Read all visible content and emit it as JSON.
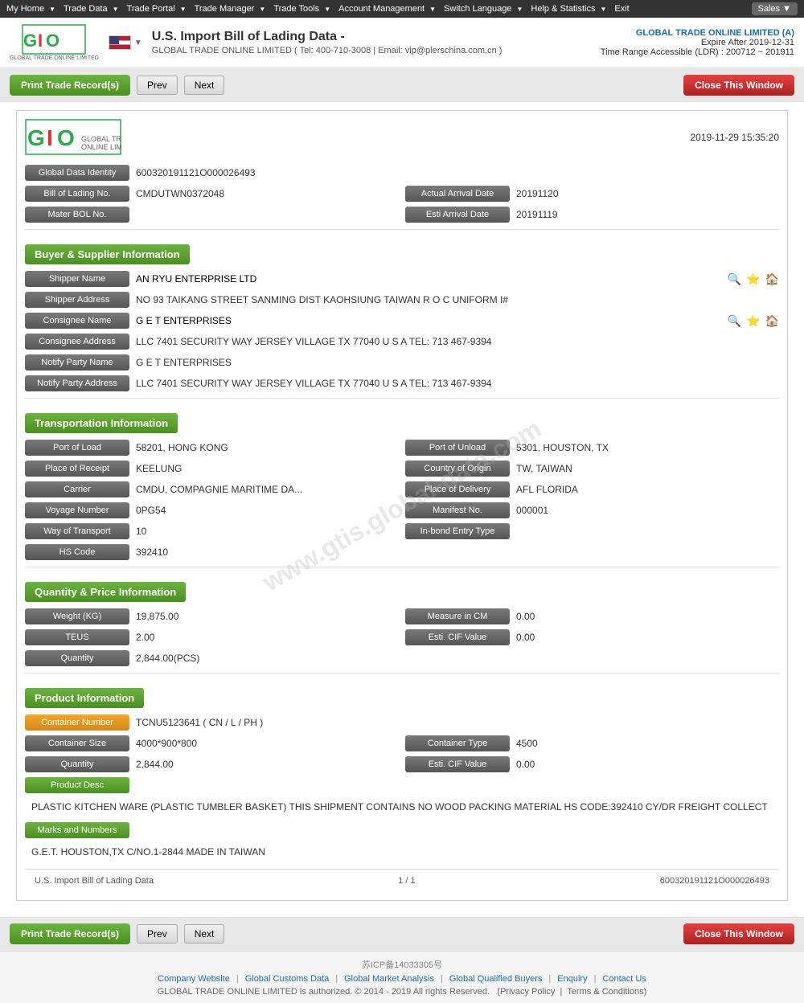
{
  "topnav": {
    "items": [
      {
        "label": "My Home",
        "hasArrow": true
      },
      {
        "label": "Trade Data",
        "hasArrow": true
      },
      {
        "label": "Trade Portal",
        "hasArrow": true
      },
      {
        "label": "Trade Manager",
        "hasArrow": true
      },
      {
        "label": "Trade Tools",
        "hasArrow": true
      },
      {
        "label": "Account Management",
        "hasArrow": true
      },
      {
        "label": "Switch Language",
        "hasArrow": true
      },
      {
        "label": "Help & Statistics",
        "hasArrow": true
      },
      {
        "label": "Exit",
        "hasArrow": false
      }
    ],
    "sales_label": "Sales"
  },
  "header": {
    "title": "U.S. Import Bill of Lading Data",
    "dash": "-",
    "company_info": "GLOBAL TRADE ONLINE LIMITED ( Tel: 400-710-3008 | Email: vip@plerschina.com.cn )",
    "account_name": "GLOBAL TRADE ONLINE LIMITED (A)",
    "expire": "Expire After 2019-12-31",
    "ldr": "Time Range Accessible (LDR) : 200712 ~ 201911",
    "logo_text": "GLOBAL TRADE ONLINE LIMITED"
  },
  "toolbar": {
    "print_label": "Print Trade Record(s)",
    "prev_label": "Prev",
    "next_label": "Next",
    "close_label": "Close This Window"
  },
  "record": {
    "timestamp": "2019-11-29 15:35:20",
    "global_data_identity_label": "Global Data Identity",
    "global_data_identity_value": "600320191121O000026493",
    "bill_of_lading_label": "Bill of Lading No.",
    "bill_of_lading_value": "CMDUTWN0372048",
    "actual_arrival_label": "Actual Arrival Date",
    "actual_arrival_value": "20191120",
    "master_bol_label": "Mater BOL No.",
    "master_bol_value": "",
    "esti_arrival_label": "Esti Arrival Date",
    "esti_arrival_value": "20191119",
    "sections": {
      "buyer_supplier": {
        "title": "Buyer & Supplier Information",
        "shipper_name_label": "Shipper Name",
        "shipper_name_value": "AN RYU ENTERPRISE LTD",
        "shipper_address_label": "Shipper Address",
        "shipper_address_value": "NO 93 TAIKANG STREET SANMING DIST KAOHSIUNG TAIWAN R O C UNIFORM I#",
        "consignee_name_label": "Consignee Name",
        "consignee_name_value": "G E T ENTERPRISES",
        "consignee_address_label": "Consignee Address",
        "consignee_address_value": "LLC 7401 SECURITY WAY JERSEY VILLAGE TX 77040 U S A TEL: 713 467-9394",
        "notify_party_name_label": "Notify Party Name",
        "notify_party_name_value": "G E T ENTERPRISES",
        "notify_party_address_label": "Notify Party Address",
        "notify_party_address_value": "LLC 7401 SECURITY WAY JERSEY VILLAGE TX 77040 U S A TEL: 713 467-9394"
      },
      "transportation": {
        "title": "Transportation Information",
        "port_of_load_label": "Port of Load",
        "port_of_load_value": "58201, HONG KONG",
        "port_of_unload_label": "Port of Unload",
        "port_of_unload_value": "5301, HOUSTON, TX",
        "place_of_receipt_label": "Place of Receipt",
        "place_of_receipt_value": "KEELUNG",
        "country_of_origin_label": "Country of Origin",
        "country_of_origin_value": "TW, TAIWAN",
        "carrier_label": "Carrier",
        "carrier_value": "CMDU, COMPAGNIE MARITIME DA...",
        "place_of_delivery_label": "Place of Delivery",
        "place_of_delivery_value": "AFL FLORIDA",
        "voyage_number_label": "Voyage Number",
        "voyage_number_value": "0PG54",
        "manifest_no_label": "Manifest No.",
        "manifest_no_value": "000001",
        "way_of_transport_label": "Way of Transport",
        "way_of_transport_value": "10",
        "inbond_entry_label": "In-bond Entry Type",
        "inbond_entry_value": "",
        "hs_code_label": "HS Code",
        "hs_code_value": "392410"
      },
      "quantity_price": {
        "title": "Quantity & Price Information",
        "weight_label": "Weight (KG)",
        "weight_value": "19,875.00",
        "measure_label": "Measure in CM",
        "measure_value": "0.00",
        "teus_label": "TEUS",
        "teus_value": "2.00",
        "esti_cif_label": "Esti. CIF Value",
        "esti_cif_value": "0.00",
        "quantity_label": "Quantity",
        "quantity_value": "2,844.00(PCS)"
      },
      "product": {
        "title": "Product Information",
        "container_number_label": "Container Number",
        "container_number_value": "TCNU5123641 ( CN / L / PH )",
        "container_size_label": "Container Size",
        "container_size_value": "4000*900*800",
        "container_type_label": "Container Type",
        "container_type_value": "4500",
        "quantity_label": "Quantity",
        "quantity_value": "2,844.00",
        "esti_cif_label": "Esti. CIF Value",
        "esti_cif_value": "0.00",
        "product_desc_label": "Product Desc",
        "product_desc_value": "PLASTIC KITCHEN WARE (PLASTIC TUMBLER BASKET) THIS SHIPMENT CONTAINS NO WOOD PACKING MATERIAL HS CODE:392410 CY/DR FREIGHT COLLECT",
        "marks_label": "Marks and Numbers",
        "marks_value": "G.E.T. HOUSTON,TX C/NO.1-2844 MADE IN TAIWAN"
      }
    },
    "footer": {
      "left": "U.S. Import Bill of Lading Data",
      "center": "1 / 1",
      "right": "600320191121O000026493"
    }
  },
  "site_footer": {
    "icp": "苏ICP备14033305号",
    "links": [
      "Company Website",
      "Global Customs Data",
      "Global Market Analysis",
      "Global Qualified Buyers",
      "Enquiry",
      "Contact Us"
    ],
    "copyright": "GLOBAL TRADE ONLINE LIMITED is authorized. © 2014 - 2019 All rights Reserved.",
    "privacy": "Privacy Policy",
    "terms": "Terms & Conditions"
  },
  "watermark": "www.gtis.global-data.com"
}
